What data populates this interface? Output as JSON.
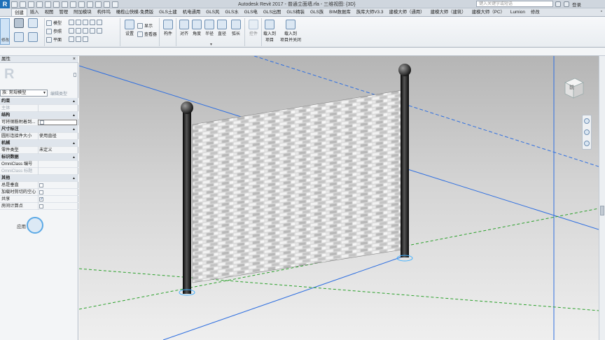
{
  "titlebar": {
    "app_letter": "R",
    "title": "Autodesk Revit 2017 -   普通立面墙.rfa - 三维视图: {3D}",
    "search_placeholder": "键入关键字或短语",
    "login": "登录"
  },
  "tabs": [
    "创建",
    "插入",
    "视图",
    "管理",
    "附加模块",
    "构件坞",
    "橄榄山快模-免费版",
    "GLS土建",
    "机电通用",
    "GLS风",
    "GLS水",
    "GLS电",
    "GLS出图",
    "GLS精装",
    "GLS族",
    "BIM数据库",
    "族库大师V3.3",
    "建模大师（通用）",
    "建模大师（建筑）",
    "建模大师（PC）",
    "Lumion",
    "修改"
  ],
  "active_tab": "创建",
  "ribbon": {
    "modify": "修改",
    "model_line": "模型",
    "reference": "参照",
    "plane": "平面",
    "set": "设置",
    "show": "显示",
    "viewer": "查看器",
    "component": "构件",
    "align": "对齐",
    "angle": "角度",
    "radius": "半径",
    "diameter": "直径",
    "arc_length": "弧长",
    "control": "控件",
    "load_into_project": [
      "载入到",
      "项目"
    ],
    "load_into_project_close": [
      "载入到",
      "项目并关闭"
    ]
  },
  "properties": {
    "title": "属性",
    "close": "×",
    "family_selector": "族: 常规模型",
    "edit_type": "编辑类型",
    "rows": [
      {
        "type": "cat",
        "key": "约束"
      },
      {
        "type": "val",
        "key": "主体",
        "value": "",
        "gray": true
      },
      {
        "type": "cat",
        "key": "结构"
      },
      {
        "type": "chk",
        "key": "可将钢筋附着到...",
        "checked": false,
        "boxed": true
      },
      {
        "type": "cat",
        "key": "尺寸标注"
      },
      {
        "type": "val",
        "key": "圆形连接件大小",
        "value": "使用直径"
      },
      {
        "type": "cat",
        "key": "机械"
      },
      {
        "type": "val",
        "key": "零件类型",
        "value": "未定义"
      },
      {
        "type": "cat",
        "key": "标识数据"
      },
      {
        "type": "val",
        "key": "OmniClass 编号",
        "value": ""
      },
      {
        "type": "val",
        "key": "OmniClass 标题",
        "value": "",
        "gray": true
      },
      {
        "type": "cat",
        "key": "其他"
      },
      {
        "type": "chk",
        "key": "总是垂直",
        "checked": false
      },
      {
        "type": "chk",
        "key": "加载时剪切的空心",
        "checked": false
      },
      {
        "type": "chk",
        "key": "共享",
        "checked": true
      },
      {
        "type": "chk",
        "key": "房间计算点",
        "checked": false
      }
    ],
    "apply": "应用"
  },
  "viewcube_label": "前",
  "colors": {
    "accent": "#1d6fb8",
    "ref_blue": "#2f6fe0",
    "ref_green": "#2aa02a",
    "post": "#1a1a1a",
    "brick": "#cfcfcf"
  }
}
